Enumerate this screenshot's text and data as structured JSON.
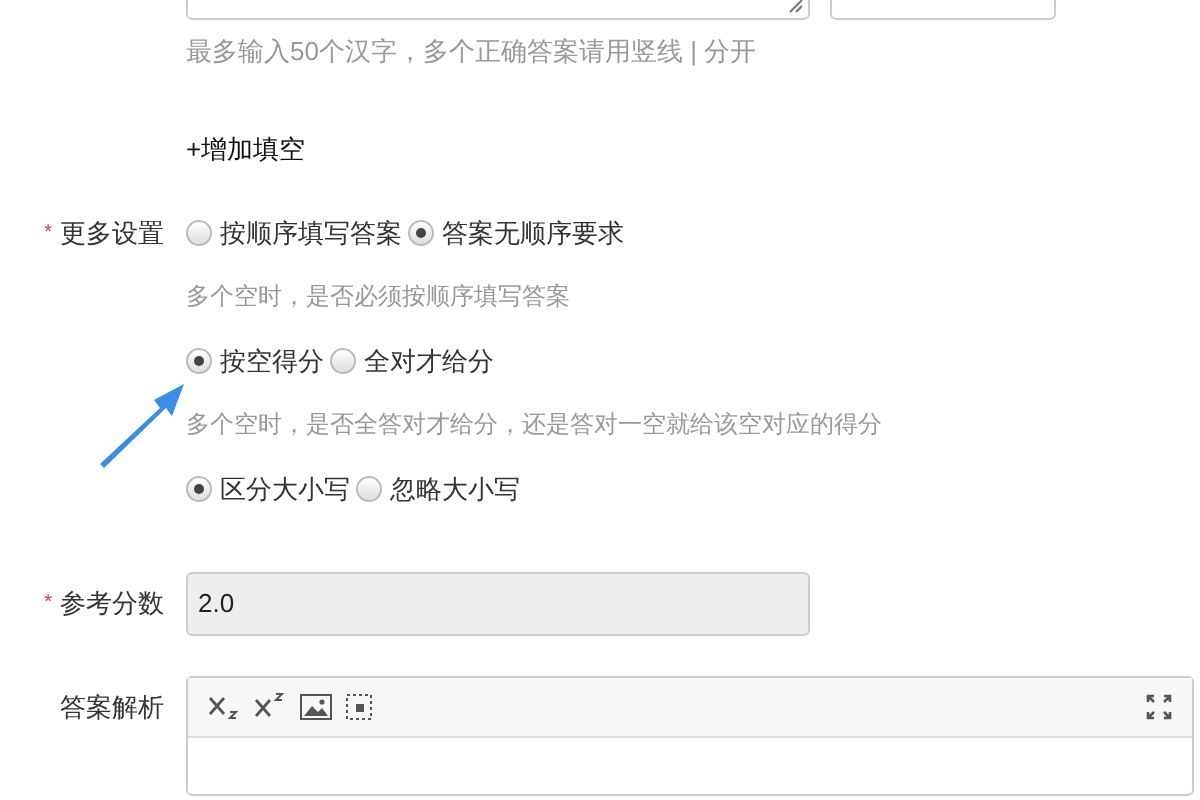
{
  "answer_hint": "最多输入50个汉字，多个正确答案请用竖线 | 分开",
  "add_blank": "+增加填空",
  "more_settings": {
    "required_mark": "*",
    "label": "更多设置",
    "groups": [
      {
        "options": [
          {
            "label": "按顺序填写答案",
            "selected": false
          },
          {
            "label": "答案无顺序要求",
            "selected": true
          }
        ],
        "hint": "多个空时，是否必须按顺序填写答案"
      },
      {
        "options": [
          {
            "label": "按空得分",
            "selected": true
          },
          {
            "label": "全对才给分",
            "selected": false
          }
        ],
        "hint": "多个空时，是否全答对才给分，还是答对一空就给该空对应的得分"
      },
      {
        "options": [
          {
            "label": "区分大小写",
            "selected": true
          },
          {
            "label": "忽略大小写",
            "selected": false
          }
        ]
      }
    ]
  },
  "score": {
    "required_mark": "*",
    "label": "参考分数",
    "value": "2.0"
  },
  "analysis": {
    "label": "答案解析",
    "toolbar": [
      {
        "kind": "subscript"
      },
      {
        "kind": "superscript"
      },
      {
        "kind": "image"
      },
      {
        "kind": "formula"
      }
    ]
  }
}
